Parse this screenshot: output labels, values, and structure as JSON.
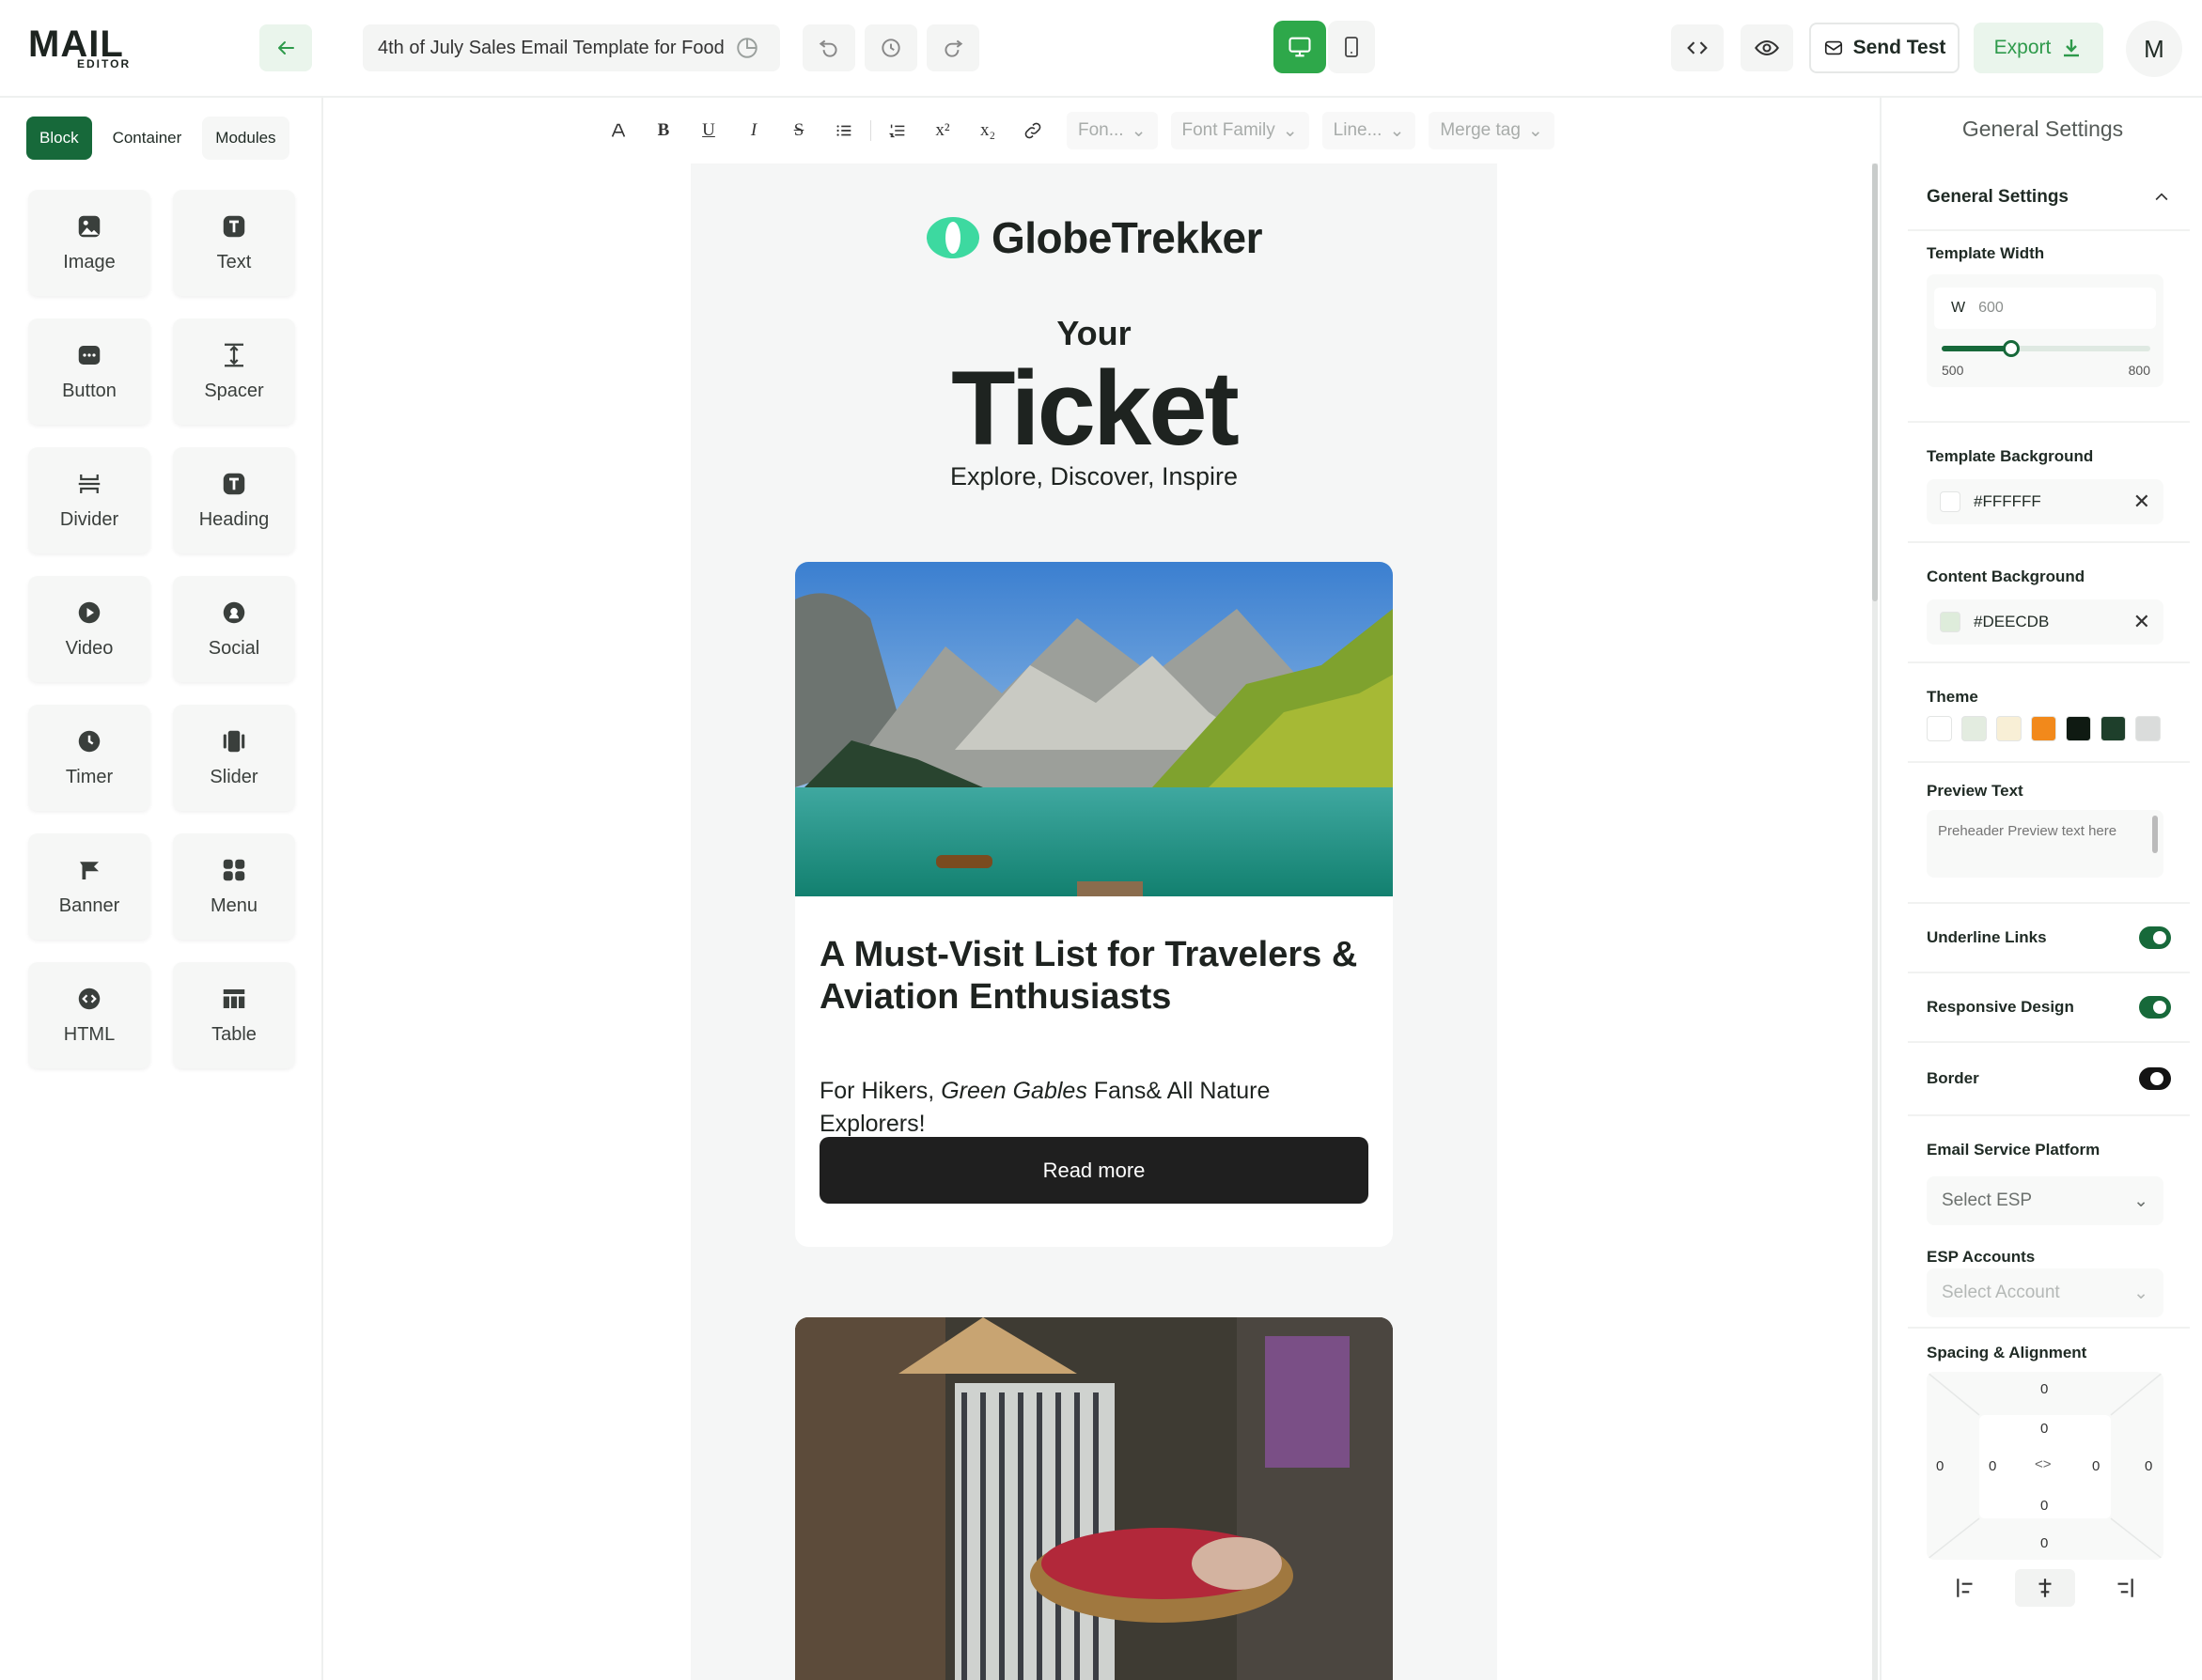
{
  "app": {
    "logo_main": "MAIL",
    "logo_sub": "EDITOR"
  },
  "topbar": {
    "template_title": "4th of July Sales Email Template for Food",
    "send_test_label": "Send Test",
    "export_label": "Export",
    "avatar_initial": "M",
    "icons": [
      "back-arrow-icon",
      "save-icon",
      "undo-icon",
      "history-icon",
      "redo-icon",
      "desktop-icon",
      "mobile-icon",
      "code-icon",
      "eye-icon",
      "mail-icon",
      "download-icon"
    ]
  },
  "sidebar": {
    "tabs": [
      {
        "label": "Block",
        "active": true
      },
      {
        "label": "Container",
        "active": false
      },
      {
        "label": "Modules",
        "active": false
      }
    ],
    "blocks": [
      {
        "label": "Image",
        "icon": "image-icon"
      },
      {
        "label": "Text",
        "icon": "text-icon"
      },
      {
        "label": "Button",
        "icon": "button-icon"
      },
      {
        "label": "Spacer",
        "icon": "spacer-icon"
      },
      {
        "label": "Divider",
        "icon": "divider-icon"
      },
      {
        "label": "Heading",
        "icon": "heading-icon"
      },
      {
        "label": "Video",
        "icon": "video-icon"
      },
      {
        "label": "Social",
        "icon": "social-icon"
      },
      {
        "label": "Timer",
        "icon": "timer-icon"
      },
      {
        "label": "Slider",
        "icon": "slider-icon"
      },
      {
        "label": "Banner",
        "icon": "banner-icon"
      },
      {
        "label": "Menu",
        "icon": "menu-icon"
      },
      {
        "label": "HTML",
        "icon": "html-icon"
      },
      {
        "label": "Table",
        "icon": "table-icon"
      }
    ]
  },
  "toolbar": {
    "font_size_placeholder": "Fon...",
    "font_family_placeholder": "Font Family",
    "line_height_placeholder": "Line...",
    "merge_tag_label": "Merge tag",
    "buttons": [
      "font-color-icon",
      "bold-icon",
      "underline-icon",
      "italic-icon",
      "strikethrough-icon",
      "bullet-list-icon",
      "numbered-list-icon",
      "superscript-icon",
      "subscript-icon",
      "link-icon"
    ]
  },
  "email": {
    "brand_name": "GlobeTrekker",
    "hero_small": "Your",
    "hero_big": "Ticket",
    "hero_sub": "Explore, Discover, Inspire",
    "card_title": "A Must-Visit List for Travelers & Aviation Enthusiasts",
    "card_text_pre": "For Hikers, ",
    "card_text_em": "Green Gables",
    "card_text_post": " Fans& All Nature Explorers!",
    "card_button": "Read more"
  },
  "panel": {
    "title": "General Settings",
    "section_title": "General Settings",
    "template_width_label": "Template Width",
    "width_prefix": "W",
    "width_value": "600",
    "width_min": "500",
    "width_max": "800",
    "width_fraction": 0.333,
    "template_background_label": "Template Background",
    "template_background_value": "#FFFFFF",
    "content_background_label": "Content Background",
    "content_background_value": "#DEECDB",
    "theme_label": "Theme",
    "theme_colors": [
      "#FFFFFF",
      "#E3ECE0",
      "#F8EFD6",
      "#F2891B",
      "#0F1A12",
      "#1E3F2B",
      "#DADCDB"
    ],
    "preview_text_label": "Preview Text",
    "preview_text_placeholder": "Preheader Preview text here",
    "underline_links_label": "Underline Links",
    "underline_links_on": true,
    "responsive_design_label": "Responsive Design",
    "responsive_design_on": true,
    "border_label": "Border",
    "border_on": false,
    "esp_label": "Email Service Platform",
    "esp_placeholder": "Select ESP",
    "esp_accounts_label": "ESP Accounts",
    "esp_accounts_placeholder": "Select Account",
    "spacing_label": "Spacing & Alignment",
    "spacing": {
      "outer_top": "0",
      "outer_left": "0",
      "outer_right": "0",
      "outer_bottom": "0",
      "inner_top": "0",
      "inner_left": "0",
      "inner_right": "0",
      "inner_bottom": "0"
    }
  },
  "colors": {
    "accent": "#17693A",
    "accent_light": "#2EA84A",
    "brand_mint": "#3DD9A0"
  }
}
